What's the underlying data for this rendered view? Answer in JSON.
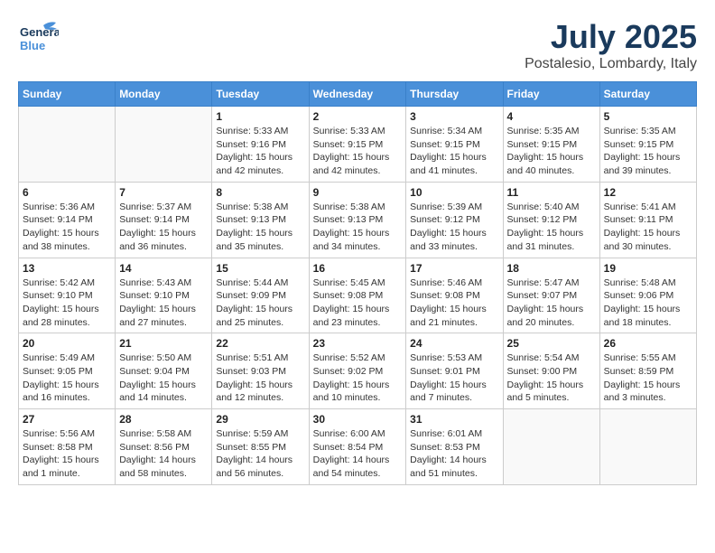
{
  "header": {
    "logo_general": "General",
    "logo_blue": "Blue",
    "month_title": "July 2025",
    "subtitle": "Postalesio, Lombardy, Italy"
  },
  "calendar": {
    "days_of_week": [
      "Sunday",
      "Monday",
      "Tuesday",
      "Wednesday",
      "Thursday",
      "Friday",
      "Saturday"
    ],
    "weeks": [
      [
        {
          "day": "",
          "info": ""
        },
        {
          "day": "",
          "info": ""
        },
        {
          "day": "1",
          "info": "Sunrise: 5:33 AM\nSunset: 9:16 PM\nDaylight: 15 hours and 42 minutes."
        },
        {
          "day": "2",
          "info": "Sunrise: 5:33 AM\nSunset: 9:15 PM\nDaylight: 15 hours and 42 minutes."
        },
        {
          "day": "3",
          "info": "Sunrise: 5:34 AM\nSunset: 9:15 PM\nDaylight: 15 hours and 41 minutes."
        },
        {
          "day": "4",
          "info": "Sunrise: 5:35 AM\nSunset: 9:15 PM\nDaylight: 15 hours and 40 minutes."
        },
        {
          "day": "5",
          "info": "Sunrise: 5:35 AM\nSunset: 9:15 PM\nDaylight: 15 hours and 39 minutes."
        }
      ],
      [
        {
          "day": "6",
          "info": "Sunrise: 5:36 AM\nSunset: 9:14 PM\nDaylight: 15 hours and 38 minutes."
        },
        {
          "day": "7",
          "info": "Sunrise: 5:37 AM\nSunset: 9:14 PM\nDaylight: 15 hours and 36 minutes."
        },
        {
          "day": "8",
          "info": "Sunrise: 5:38 AM\nSunset: 9:13 PM\nDaylight: 15 hours and 35 minutes."
        },
        {
          "day": "9",
          "info": "Sunrise: 5:38 AM\nSunset: 9:13 PM\nDaylight: 15 hours and 34 minutes."
        },
        {
          "day": "10",
          "info": "Sunrise: 5:39 AM\nSunset: 9:12 PM\nDaylight: 15 hours and 33 minutes."
        },
        {
          "day": "11",
          "info": "Sunrise: 5:40 AM\nSunset: 9:12 PM\nDaylight: 15 hours and 31 minutes."
        },
        {
          "day": "12",
          "info": "Sunrise: 5:41 AM\nSunset: 9:11 PM\nDaylight: 15 hours and 30 minutes."
        }
      ],
      [
        {
          "day": "13",
          "info": "Sunrise: 5:42 AM\nSunset: 9:10 PM\nDaylight: 15 hours and 28 minutes."
        },
        {
          "day": "14",
          "info": "Sunrise: 5:43 AM\nSunset: 9:10 PM\nDaylight: 15 hours and 27 minutes."
        },
        {
          "day": "15",
          "info": "Sunrise: 5:44 AM\nSunset: 9:09 PM\nDaylight: 15 hours and 25 minutes."
        },
        {
          "day": "16",
          "info": "Sunrise: 5:45 AM\nSunset: 9:08 PM\nDaylight: 15 hours and 23 minutes."
        },
        {
          "day": "17",
          "info": "Sunrise: 5:46 AM\nSunset: 9:08 PM\nDaylight: 15 hours and 21 minutes."
        },
        {
          "day": "18",
          "info": "Sunrise: 5:47 AM\nSunset: 9:07 PM\nDaylight: 15 hours and 20 minutes."
        },
        {
          "day": "19",
          "info": "Sunrise: 5:48 AM\nSunset: 9:06 PM\nDaylight: 15 hours and 18 minutes."
        }
      ],
      [
        {
          "day": "20",
          "info": "Sunrise: 5:49 AM\nSunset: 9:05 PM\nDaylight: 15 hours and 16 minutes."
        },
        {
          "day": "21",
          "info": "Sunrise: 5:50 AM\nSunset: 9:04 PM\nDaylight: 15 hours and 14 minutes."
        },
        {
          "day": "22",
          "info": "Sunrise: 5:51 AM\nSunset: 9:03 PM\nDaylight: 15 hours and 12 minutes."
        },
        {
          "day": "23",
          "info": "Sunrise: 5:52 AM\nSunset: 9:02 PM\nDaylight: 15 hours and 10 minutes."
        },
        {
          "day": "24",
          "info": "Sunrise: 5:53 AM\nSunset: 9:01 PM\nDaylight: 15 hours and 7 minutes."
        },
        {
          "day": "25",
          "info": "Sunrise: 5:54 AM\nSunset: 9:00 PM\nDaylight: 15 hours and 5 minutes."
        },
        {
          "day": "26",
          "info": "Sunrise: 5:55 AM\nSunset: 8:59 PM\nDaylight: 15 hours and 3 minutes."
        }
      ],
      [
        {
          "day": "27",
          "info": "Sunrise: 5:56 AM\nSunset: 8:58 PM\nDaylight: 15 hours and 1 minute."
        },
        {
          "day": "28",
          "info": "Sunrise: 5:58 AM\nSunset: 8:56 PM\nDaylight: 14 hours and 58 minutes."
        },
        {
          "day": "29",
          "info": "Sunrise: 5:59 AM\nSunset: 8:55 PM\nDaylight: 14 hours and 56 minutes."
        },
        {
          "day": "30",
          "info": "Sunrise: 6:00 AM\nSunset: 8:54 PM\nDaylight: 14 hours and 54 minutes."
        },
        {
          "day": "31",
          "info": "Sunrise: 6:01 AM\nSunset: 8:53 PM\nDaylight: 14 hours and 51 minutes."
        },
        {
          "day": "",
          "info": ""
        },
        {
          "day": "",
          "info": ""
        }
      ]
    ]
  }
}
